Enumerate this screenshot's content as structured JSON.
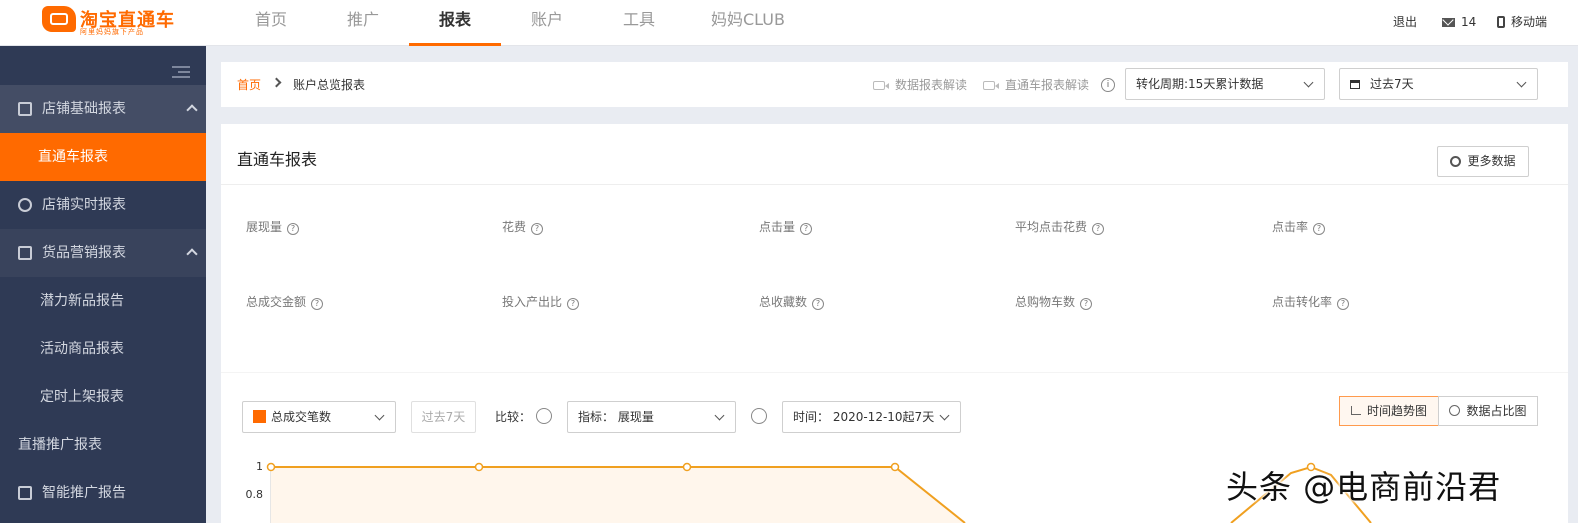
{
  "header": {
    "logo_title": "淘宝直通车",
    "logo_sub": "阿里妈妈旗下产品",
    "nav": [
      "首页",
      "推广",
      "报表",
      "账户",
      "工具",
      "妈妈CLUB"
    ],
    "active_nav": "报表",
    "logout": "退出",
    "mail_count": "14",
    "mobile": "移动端"
  },
  "sidebar": {
    "items": [
      {
        "label": "店铺基础报表",
        "icon": "report-icon"
      },
      {
        "label": "直通车报表"
      },
      {
        "label": "店铺实时报表",
        "icon": "clock-icon"
      },
      {
        "label": "货品营销报表",
        "icon": "monitor-icon"
      },
      {
        "label": "潜力新品报告"
      },
      {
        "label": "活动商品报表"
      },
      {
        "label": "定时上架报表"
      },
      {
        "label": "直播推广报表"
      },
      {
        "label": "智能推广报告",
        "icon": "smart-icon"
      }
    ]
  },
  "breadcrumb": {
    "home": "首页",
    "current": "账户总览报表",
    "help1": "数据报表解读",
    "help2": "直通车报表解读",
    "period_select": "转化周期:15天累计数据",
    "date_select": "过去7天"
  },
  "card": {
    "title": "直通车报表",
    "more_button": "更多数据",
    "metrics_row1": [
      "展现量",
      "花费",
      "点击量",
      "平均点击花费",
      "点击率"
    ],
    "metrics_row2": [
      "总成交金额",
      "投入产出比",
      "总收藏数",
      "总购物车数",
      "点击转化率"
    ]
  },
  "chart_controls": {
    "metric_select": "总成交笔数",
    "range_button": "过去7天",
    "compare_label": "比较：",
    "indicator_select": "指标： 展现量",
    "time_select": "时间： 2020-12-10起7天",
    "trend_tab": "时间趋势图",
    "share_tab": "数据占比图"
  },
  "chart_data": {
    "type": "area",
    "yticks": [
      "1",
      "0.8"
    ],
    "ylim": [
      0,
      1
    ],
    "series": [
      {
        "values": [
          1,
          1,
          1,
          1
        ]
      }
    ]
  },
  "watermark": "头条 @电商前沿君",
  "colors": {
    "accent": "#ff6a00",
    "sidebar": "#2f3a55"
  }
}
